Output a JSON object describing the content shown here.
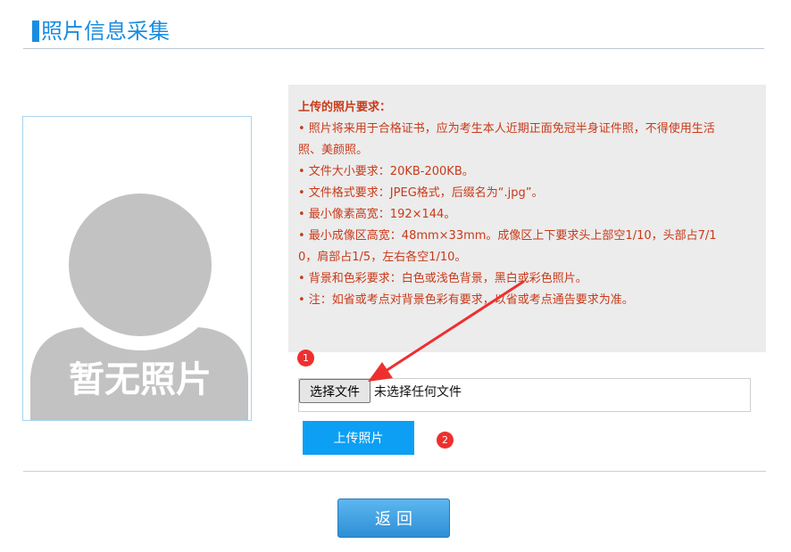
{
  "page": {
    "title": "照片信息采集"
  },
  "photo": {
    "placeholder_text": "暂无照片"
  },
  "requirements": {
    "heading": "上传的照片要求：",
    "lines": [
      "• 照片将来用于合格证书，应为考生本人近期正面免冠半身证件照，不得使用生活",
      "照、美颜照。",
      "• 文件大小要求：20KB-200KB。",
      "• 文件格式要求：JPEG格式，后缀名为“.jpg”。",
      "• 最小像素高宽：192×144。",
      "• 最小成像区高宽：48mm×33mm。成像区上下要求头上部空1/10，头部占7/1",
      "0，肩部占1/5，左右各空1/10。",
      "• 背景和色彩要求：白色或浅色背景，黑白或彩色照片。",
      "• 注：如省或考点对背景色彩有要求，以省或考点通告要求为准。"
    ]
  },
  "upload": {
    "choose_file_label": "选择文件",
    "no_file_text": "未选择任何文件",
    "upload_button_label": "上传照片"
  },
  "annotations": {
    "step1": "1",
    "step2": "2",
    "arrow_color": "#ee2f2f"
  },
  "footer": {
    "back_button_label": "返回"
  },
  "colors": {
    "accent": "#1a8de0",
    "upload_button": "#0c9ff4",
    "requirement_text": "#c83a1a"
  }
}
